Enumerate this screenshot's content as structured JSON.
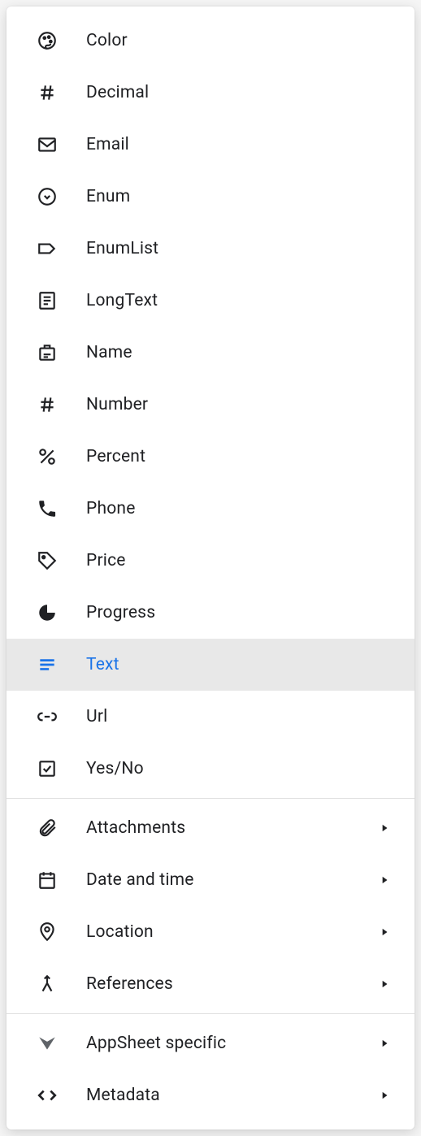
{
  "colors": {
    "accent": "#1a73e8",
    "text": "#202124",
    "selectedBg": "#e8e8e8",
    "divider": "#e0e0e0"
  },
  "items": {
    "color": {
      "label": "Color",
      "icon": "palette-icon"
    },
    "decimal": {
      "label": "Decimal",
      "icon": "hash-icon"
    },
    "email": {
      "label": "Email",
      "icon": "mail-icon"
    },
    "enum": {
      "label": "Enum",
      "icon": "circle-down-icon"
    },
    "enumlist": {
      "label": "EnumList",
      "icon": "tag-outline-icon"
    },
    "longtext": {
      "label": "LongText",
      "icon": "document-lines-icon"
    },
    "name": {
      "label": "Name",
      "icon": "badge-icon"
    },
    "number": {
      "label": "Number",
      "icon": "hash-icon"
    },
    "percent": {
      "label": "Percent",
      "icon": "percent-icon"
    },
    "phone": {
      "label": "Phone",
      "icon": "phone-icon"
    },
    "price": {
      "label": "Price",
      "icon": "price-tag-icon"
    },
    "progress": {
      "label": "Progress",
      "icon": "pie-icon"
    },
    "text": {
      "label": "Text",
      "icon": "text-lines-icon"
    },
    "url": {
      "label": "Url",
      "icon": "link-icon"
    },
    "yesno": {
      "label": "Yes/No",
      "icon": "checkbox-icon"
    }
  },
  "groups": {
    "attachments": {
      "label": "Attachments",
      "icon": "paperclip-icon"
    },
    "datetime": {
      "label": "Date and time",
      "icon": "calendar-icon"
    },
    "location": {
      "label": "Location",
      "icon": "pin-icon"
    },
    "references": {
      "label": "References",
      "icon": "merge-icon"
    },
    "appsheet": {
      "label": "AppSheet specific",
      "icon": "appsheet-icon"
    },
    "metadata": {
      "label": "Metadata",
      "icon": "code-icon"
    }
  }
}
